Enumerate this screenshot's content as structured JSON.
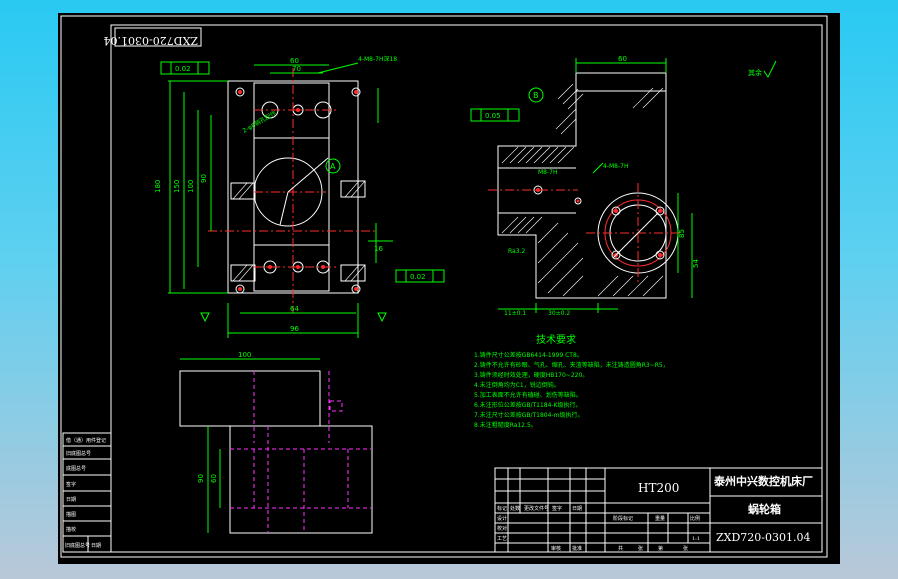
{
  "drawing": {
    "number_box": "ZXD720-0301.04",
    "title_block": {
      "material": "HT200",
      "company": "泰州中兴数控机床厂",
      "part_name": "蜗轮箱",
      "drawing_number": "ZXD720-0301.04"
    },
    "tech_requirements": {
      "title": "技术要求",
      "lines": [
        "1.铸件尺寸公差按GB6414-1999 CT8。",
        "2.铸件不允许有砂眼、气孔、缩孔、夹渣等缺陷，未注铸造圆角R3~R5，",
        "3.铸件须经时效处理，硬度HB170~220。",
        "4.未注倒角均为C1，锐边倒钝。",
        "5.加工表面不允许有磕碰、划伤等缺陷。",
        "6.未注形位公差按GB/T1184-K级执行。",
        "7.未注尺寸公差按GB/T1804-m级执行。",
        "8.未注粗糙度Ra12.5。"
      ]
    },
    "roughness_note": "其余",
    "labels": {
      "datum_a": "A",
      "datum_b": "B",
      "thread_top": "4-M8-7H深18",
      "thread_side": "4-M8-7H",
      "hole_note": "2-φ6销孔配作",
      "gauge_1": "0.02",
      "gauge_2": "0.05",
      "gauge_3": "0.02",
      "dim_1": "96",
      "dim_2": "64",
      "dim_3": "70",
      "dim_4": "180",
      "dim_5": "150",
      "dim_6": "100",
      "dim_7": "90",
      "dim_8": "60",
      "dim_9": "16",
      "dim_10": "12",
      "dim_11": "M8-7H",
      "dim_12": "Ra3.2",
      "dim_13": "30±0.2",
      "dim_14": "11±0.1",
      "dim_15": "54",
      "dim_16": "85"
    },
    "side_labels": [
      "借（通）用件登记",
      "旧底图总号",
      "底图总号",
      "签字",
      "日期",
      "描图",
      "描校",
      "旧底图总号",
      "日期"
    ],
    "tb_small": [
      "标记",
      "处数",
      "更改文件号",
      "签字",
      "日期",
      "设计",
      "校对",
      "工艺",
      "审核",
      "批准",
      "阶段标记",
      "重量",
      "比例",
      "1:1",
      "共",
      "张",
      "第",
      "张"
    ]
  },
  "colors": {
    "outline": "#ffffff",
    "dimension": "#00ff00",
    "center_line": "#ff2b2b",
    "hidden_line": "#ff33ff",
    "background": "#000000"
  }
}
